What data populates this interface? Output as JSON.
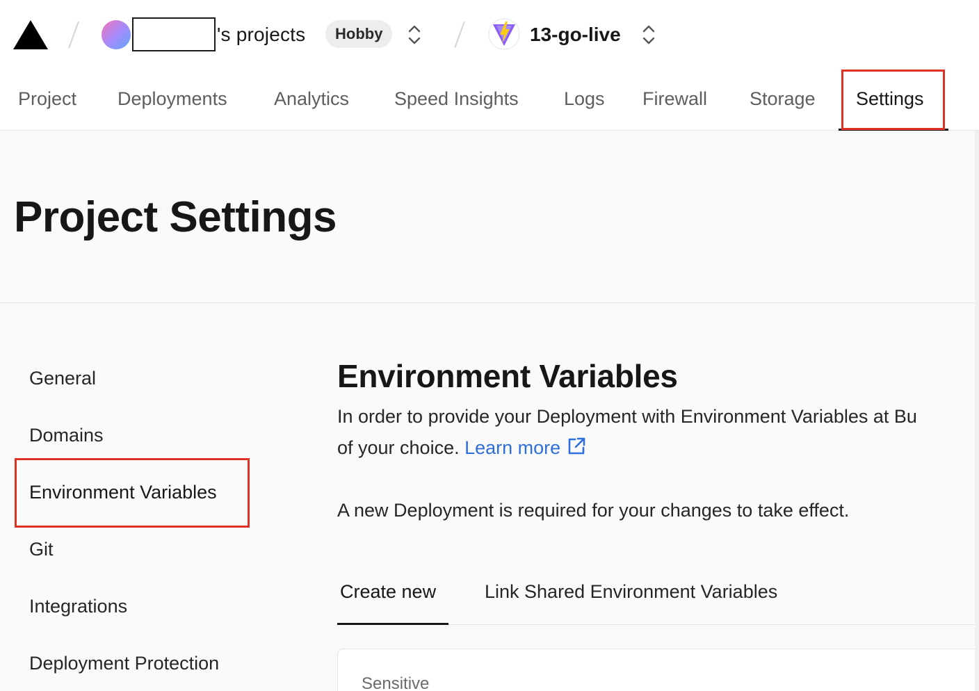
{
  "header": {
    "team_suffix": "'s projects",
    "plan_badge": "Hobby",
    "project_name": "13-go-live"
  },
  "nav": {
    "tabs": [
      {
        "label": "Project"
      },
      {
        "label": "Deployments"
      },
      {
        "label": "Analytics"
      },
      {
        "label": "Speed Insights"
      },
      {
        "label": "Logs"
      },
      {
        "label": "Firewall"
      },
      {
        "label": "Storage"
      },
      {
        "label": "Settings",
        "active": true
      }
    ]
  },
  "page": {
    "title": "Project Settings"
  },
  "sidebar": {
    "items": [
      {
        "label": "General"
      },
      {
        "label": "Domains"
      },
      {
        "label": "Environment Variables",
        "active": true
      },
      {
        "label": "Git"
      },
      {
        "label": "Integrations"
      },
      {
        "label": "Deployment Protection"
      }
    ]
  },
  "main": {
    "title": "Environment Variables",
    "description_line1": "In order to provide your Deployment with Environment Variables at Bu",
    "description_line2_prefix": "of your choice. ",
    "learn_more": "Learn more",
    "notice": "A new Deployment is required for your changes to take effect.",
    "tabs": [
      {
        "label": "Create new",
        "active": true
      },
      {
        "label": "Link Shared Environment Variables"
      }
    ],
    "card": {
      "label": "Sensitive"
    }
  },
  "colors": {
    "highlight": "#e03127",
    "link": "#2f6fdc",
    "text": "#171717"
  }
}
